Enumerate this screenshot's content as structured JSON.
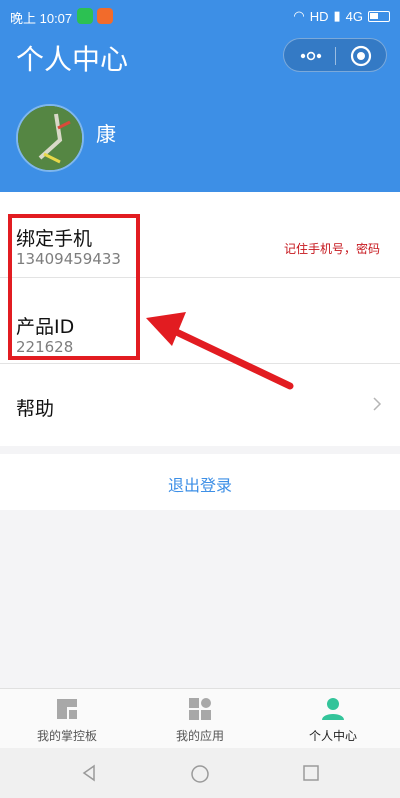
{
  "status_bar": {
    "time": "晚上 10:07",
    "network": "HD",
    "signal_label": "4G"
  },
  "header": {
    "title": "个人中心",
    "username": "康"
  },
  "list": {
    "phone": {
      "label": "绑定手机",
      "value": "13409459433"
    },
    "product": {
      "label": "产品ID",
      "value": "221628"
    },
    "help": {
      "label": "帮助"
    }
  },
  "annotation": {
    "note": "记住手机号，密码"
  },
  "logout": {
    "label": "退出登录"
  },
  "tabs": [
    {
      "label": "我的掌控板",
      "icon": "dashboard-icon"
    },
    {
      "label": "我的应用",
      "icon": "apps-icon"
    },
    {
      "label": "个人中心",
      "icon": "person-icon",
      "active": true
    }
  ],
  "colors": {
    "brand": "#3d8fe6",
    "accent_tab": "#33c49a",
    "annotation": "#e21c21"
  }
}
